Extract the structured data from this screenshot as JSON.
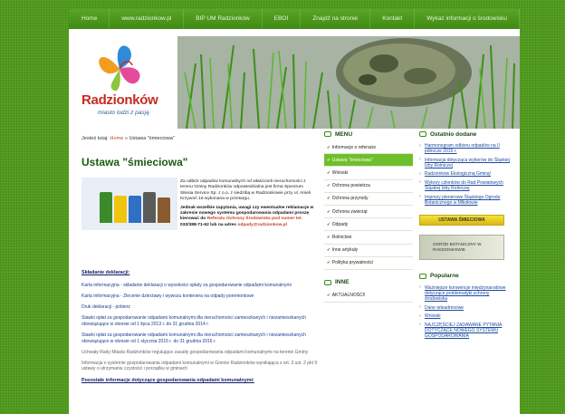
{
  "nav": [
    "Home",
    "www.radzionkow.pl",
    "BIP UM Radzionków",
    "EBOI",
    "Znajdź na stronie",
    "Kontakt",
    "Wykaz informacji o środowisku"
  ],
  "brand": {
    "name": "Radzionków",
    "tagline": "miasto ludzi z pasją"
  },
  "breadcrumb": {
    "prefix": "Jesteś tutaj:",
    "home": "Home",
    "sep": "»",
    "current": "Ustawa \"śmieciowa\""
  },
  "title": "Ustawa \"śmieciowa\"",
  "intro": {
    "p1": "Za odbiór odpadów komunalnych od właścicieli nieruchomości z terenu Gminy Radzionków odpowiedzialna jest firma Spectrum Silesia Service Sp. z o.o. z siedzibą w Radzionkowie przy ul. Anieli Krzywoń 16 wykonana w przetargu.",
    "p2": "Jednak wszelkie zapytania, uwagi czy ewentualne reklamacje w zakresie nowego systemu gospodarowania odpadami proszę kierować do",
    "ref": "Referatu Ochrony Środowiska pod numer tel.",
    "tel": "032/388-71-62 lub na adres",
    "email": "odpady@radzionkow.pl"
  },
  "content": {
    "section1": "Składanie deklaracji:",
    "items": [
      "Karta informacyjna - składanie deklaracji o wysokości opłaty za gospodarowanie odpadami komunalnymi",
      "Karta informacyjna - Zlecenie dzierżawy i wywozu kontenera na odpady poremontowe",
      "Druk deklaracji - pobierz",
      "Stawki opłat za gospodarowanie odpadami komunalnymi dla nieruchomości zamieszkanych i niezamieszkanych obowiązujące w okresie od 1 lipca 2013 r. do 31 grudnia 2014 r.",
      "Stawki opłat za gospodarowanie odpadami komunalnymi dla nieruchomości zamieszkanych i niezamieszkanych obowiązujące w okresie od 1 stycznia 2015 r. do 31 grudnia 2016 r."
    ],
    "grey": [
      "Uchwały Rady Miasta Radzionków regulujące zasady gospodarowania odpadami komunalnymi na terenie Gminy",
      "Informacja o systemie gospodarowania odpadami komunalnymi w Gminie Radzionków wynikająca z art. 3 ust. 2 pkt 9 ustawy o utrzymaniu czystości i porządku w gminach"
    ],
    "section2": "Pozostałe informacje dotyczące gospodarowania odpadami komunalnymi:"
  },
  "menu": {
    "title": "MENU",
    "items": [
      "Informacje o referacie",
      "Ustawa \"śmieciowa\"",
      "Wnioski",
      "Ochrona powietrza",
      "Ochrona przyrody",
      "Ochrona zwierząt",
      "Odpady",
      "Rolnictwo",
      "Inne artykuły",
      "Polityka prywatności"
    ],
    "inne_title": "INNE",
    "inne_items": [
      "AKTUALNOŚCI!"
    ]
  },
  "recent": {
    "title": "Ostatnio dodane",
    "items": [
      "Harmonogram odbioru odpadów na II półrocze 2015 r.",
      "Informacja dotycząca wyborów do Śląskiej Izby Rolniczej",
      "Radzionków Ekologiczną Gminą!",
      "Wybory członków do Rad Powiatowych Śląskiej Izby Rolniczej",
      "Imprezy plenerowe Śląskiego Ogrodu Botanicznego w Mikołowie"
    ]
  },
  "banners": {
    "smieciowa": "USTAWA ŚMIECIOWA",
    "ogrod": "OGRÓD BOTANICZNY W RADZIONKOWIE"
  },
  "popular": {
    "title": "Popularne",
    "items": [
      "Ważniejsze konwencje międzynarodowe dotyczące problematyki ochrony środowiska",
      "Dane teleadresowe",
      "Wnioski",
      "NAJCZĘŚCIEJ ZADAWANE PYTANIA DOTYCZĄCE NOWEGO SYSTEMU GOSPODAROWANIA"
    ]
  },
  "colors": {
    "accent": "#6fbf2d",
    "brand_red": "#c62b21",
    "link": "#1c4a9f"
  }
}
